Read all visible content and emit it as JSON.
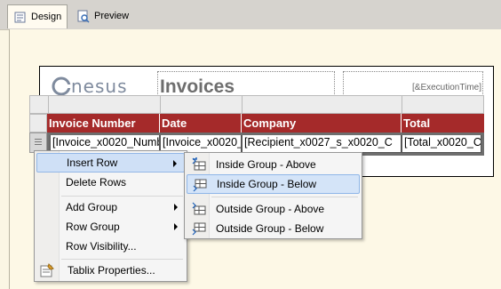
{
  "tabs": [
    {
      "label": "Design",
      "active": true,
      "icon": "design-icon"
    },
    {
      "label": "Preview",
      "active": false,
      "icon": "preview-icon"
    }
  ],
  "report": {
    "logo_text": "nesus",
    "title": "Invoices",
    "execution_time": "[&ExecutionTime]"
  },
  "tablix": {
    "headers": [
      "Invoice Number",
      "Date",
      "Company",
      "Total"
    ],
    "cells": [
      "[Invoice_x0020_Numb",
      "[Invoice_x0020_",
      "[Recipient_x0027_s_x0020_C",
      "[Total_x0020_C"
    ]
  },
  "context_menu": {
    "items": [
      {
        "label": "Insert Row",
        "submenu": true,
        "highlighted": true
      },
      {
        "label": "Delete Rows"
      },
      {
        "label": "Add Group",
        "submenu": true
      },
      {
        "label": "Row Group",
        "submenu": true
      },
      {
        "label": "Row Visibility..."
      },
      {
        "label": "Tablix Properties...",
        "icon": "properties-icon"
      }
    ]
  },
  "submenu": {
    "items": [
      {
        "label": "Inside Group - Above",
        "icon": "insert-above-icon"
      },
      {
        "label": "Inside Group - Below",
        "icon": "insert-below-icon",
        "highlighted": true
      },
      {
        "label": "Outside Group - Above",
        "icon": "insert-above-icon"
      },
      {
        "label": "Outside Group - Below",
        "icon": "insert-below-icon"
      }
    ]
  },
  "colors": {
    "header_bg": "#a52a2a",
    "highlight": "#d4e4f8"
  }
}
